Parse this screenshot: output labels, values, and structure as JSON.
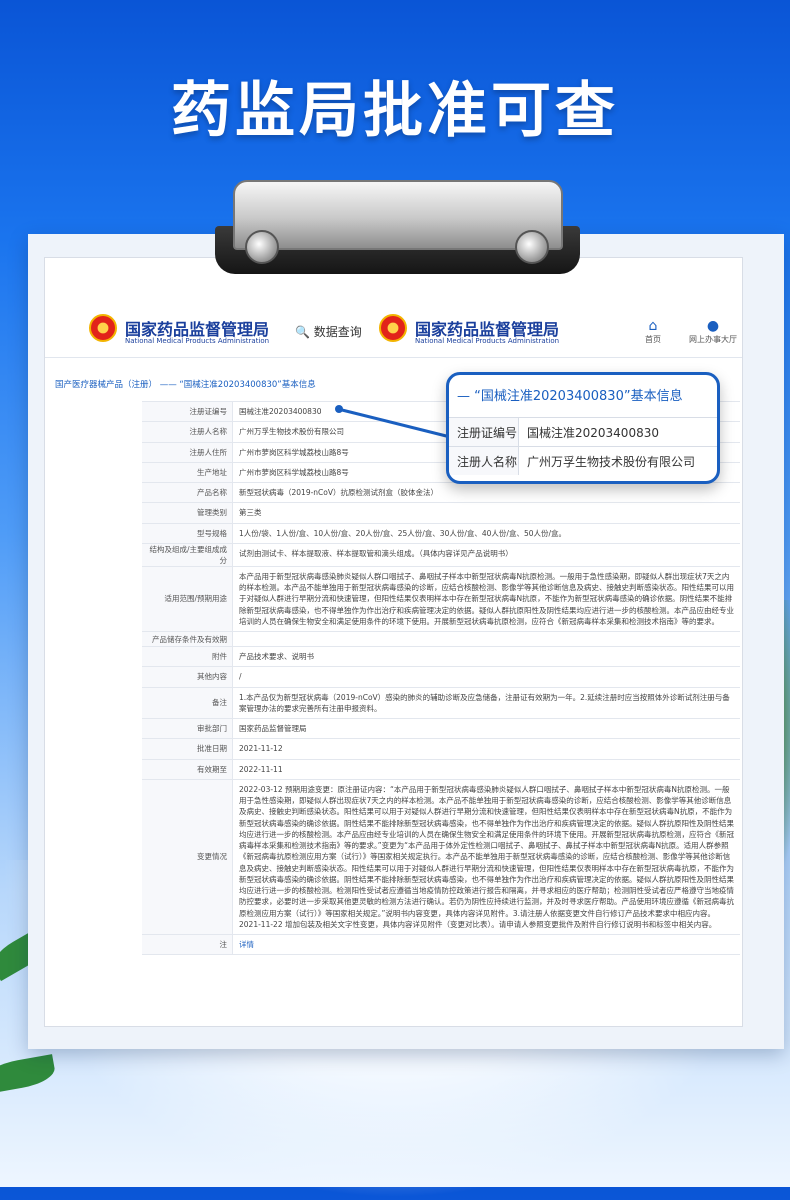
{
  "headline": "药监局批准可查",
  "header": {
    "brand_cn": "国家药品监督管理局",
    "brand_en": "National Medical Products Administration",
    "query_label": "数据查询",
    "home_label": "首页",
    "office_label": "网上办事大厅"
  },
  "breadcrumb": "国产医疗器械产品（注册） —— “国械注准20203400830”基本信息",
  "callout": {
    "title": "— “国械注准20203400830”基本信息",
    "rows": [
      {
        "k": "注册证编号",
        "v": "国械注准20203400830"
      },
      {
        "k": "注册人名称",
        "v": "广州万孚生物技术股份有限公司"
      }
    ]
  },
  "rows": [
    {
      "k": "注册证编号",
      "v": "国械注准20203400830"
    },
    {
      "k": "注册人名称",
      "v": "广州万孚生物技术股份有限公司"
    },
    {
      "k": "注册人住所",
      "v": "广州市萝岗区科学城荔枝山路8号"
    },
    {
      "k": "生产地址",
      "v": "广州市萝岗区科学城荔枝山路8号"
    },
    {
      "k": "产品名称",
      "v": "新型冠状病毒（2019-nCoV）抗原检测试剂盒（胶体金法）"
    },
    {
      "k": "管理类别",
      "v": "第三类"
    },
    {
      "k": "型号规格",
      "v": "1人份/袋、1人份/盒、10人份/盒、20人份/盒、25人份/盒、30人份/盒、40人份/盒、50人份/盒。"
    },
    {
      "k": "结构及组成/主要组成成分",
      "v": "试剂由测试卡、样本提取液、样本提取管和滴头组成。（具体内容详见产品说明书）"
    },
    {
      "k": "适用范围/预期用途",
      "v": "本产品用于新型冠状病毒感染肺炎疑似人群口咽拭子、鼻咽拭子样本中新型冠状病毒N抗原检测。一般用于急性感染期，即疑似人群出现症状7天之内的样本检测。本产品不能单独用于新型冠状病毒感染的诊断，应结合核酸检测、影像学等其他诊断信息及病史、接触史判断感染状态。阳性结果可以用于对疑似人群进行早期分流和快速管理，但阳性结果仅表明样本中存在新型冠状病毒N抗原，不能作为新型冠状病毒感染的确诊依据。阴性结果不能排除新型冠状病毒感染，也不得单独作为作出治疗和疾病管理决定的依据。疑似人群抗原阳性及阴性结果均应进行进一步的核酸检测。本产品应由经专业培训的人员在确保生物安全和满足使用条件的环境下使用。开展新型冠状病毒抗原检测，应符合《新冠病毒样本采集和检测技术指南》等的要求。"
    },
    {
      "k": "产品储存条件及有效期",
      "v": ""
    },
    {
      "k": "附件",
      "v": "产品技术要求、说明书"
    },
    {
      "k": "其他内容",
      "v": "/"
    },
    {
      "k": "备注",
      "v": "1.本产品仅为新型冠状病毒（2019-nCoV）感染的肺炎的辅助诊断及应急储备，注册证有效期为一年。2.延续注册时应当按照体外诊断试剂注册与备案管理办法的要求完善所有注册申报资料。"
    },
    {
      "k": "审批部门",
      "v": "国家药品监督管理局"
    },
    {
      "k": "批准日期",
      "v": "2021-11-12"
    },
    {
      "k": "有效期至",
      "v": "2022-11-11"
    },
    {
      "k": "变更情况",
      "v": "2022-03-12 预期用途变更：原注册证内容：“本产品用于新型冠状病毒感染肺炎疑似人群口咽拭子、鼻咽拭子样本中新型冠状病毒N抗原检测。一般用于急性感染期，即疑似人群出现症状7天之内的样本检测。本产品不能单独用于新型冠状病毒感染的诊断，应结合核酸检测、影像学等其他诊断信息及病史、接触史判断感染状态。阳性结果可以用于对疑似人群进行早期分流和快速管理，但阳性结果仅表明样本中存在新型冠状病毒N抗原，不能作为新型冠状病毒感染的确诊依据。阴性结果不能排除新型冠状病毒感染，也不得单独作为作出治疗和疾病管理决定的依据。疑似人群抗原阳性及阴性结果均应进行进一步的核酸检测。本产品应由经专业培训的人员在确保生物安全和满足使用条件的环境下使用。开展新型冠状病毒抗原检测，应符合《新冠病毒样本采集和检测技术指南》等的要求。”变更为“本产品用于体外定性检测口咽拭子、鼻咽拭子、鼻拭子样本中新型冠状病毒N抗原。适用人群参照《新冠病毒抗原检测应用方案（试行）》等国家相关规定执行。本产品不能单独用于新型冠状病毒感染的诊断，应结合核酸检测、影像学等其他诊断信息及病史、接触史判断感染状态。阳性结果可以用于对疑似人群进行早期分流和快速管理，但阳性结果仅表明样本中存在新型冠状病毒抗原，不能作为新型冠状病毒感染的确诊依据。阴性结果不能排除新型冠状病毒感染，也不得单独作为作出治疗和疾病管理决定的依据。疑似人群抗原阳性及阴性结果均应进行进一步的核酸检测。检测阳性受试者应遵循当地疫情防控政策进行报告和隔离，并寻求相应的医疗帮助；检测阴性受试者应严格遵守当地疫情防控要求，必要时进一步采取其他更灵敏的检测方法进行确认。若仍为阴性应持续进行监测，并及时寻求医疗帮助。产品使用环境应遵循《新冠病毒抗原检测应用方案（试行）》等国家相关规定。”说明书内容变更，具体内容详见附件。3.请注册人依据变更文件自行修订产品技术要求中相应内容。2021-11-22 增加包装及相关文字性变更，具体内容详见附件（变更对比表）。请申请人参照变更批件及附件自行修订说明书和标签中相关内容。"
    },
    {
      "k": "注",
      "v": "详情"
    }
  ]
}
